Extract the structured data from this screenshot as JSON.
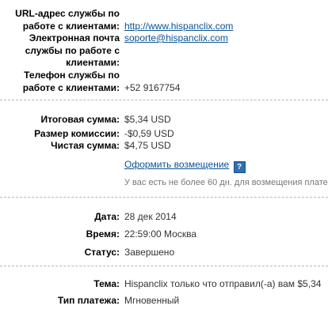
{
  "contact": {
    "url_label": "URL-адрес службы по работе с клиентами:",
    "url_label_lines": [
      "URL-адрес службы по",
      "работе с клиентами:"
    ],
    "url_value": "http://www.hispanclix.com",
    "email_label_lines": [
      "Электронная почта",
      "службы по работе с",
      "клиентами:"
    ],
    "email_value": "soporte@hispanclix.com",
    "phone_label_lines": [
      "Телефон службы по",
      "работе с клиентами:"
    ],
    "phone_value": "+52 9167754"
  },
  "amounts": {
    "total_label": "Итоговая сумма:",
    "total_value": "$5,34 USD",
    "fee_label": "Размер комиссии:",
    "fee_value": "-$0,59 USD",
    "net_label": "Чистая сумма:",
    "net_value": "$4,75 USD",
    "refund_link": "Оформить возмещение",
    "help_icon": "?",
    "refund_note": "У вас есть не более 60 дн. для возмещения плате"
  },
  "details": {
    "date_label": "Дата:",
    "date_value": "28 дек 2014",
    "time_label": "Время:",
    "time_value": "22:59:00 Москва",
    "status_label": "Статус:",
    "status_value": "Завершено"
  },
  "payment": {
    "subject_label": "Тема:",
    "subject_value": "Hispanclix только что отправил(-а) вам $5,34",
    "type_label": "Тип платежа:",
    "type_value": "Мгновенный"
  }
}
